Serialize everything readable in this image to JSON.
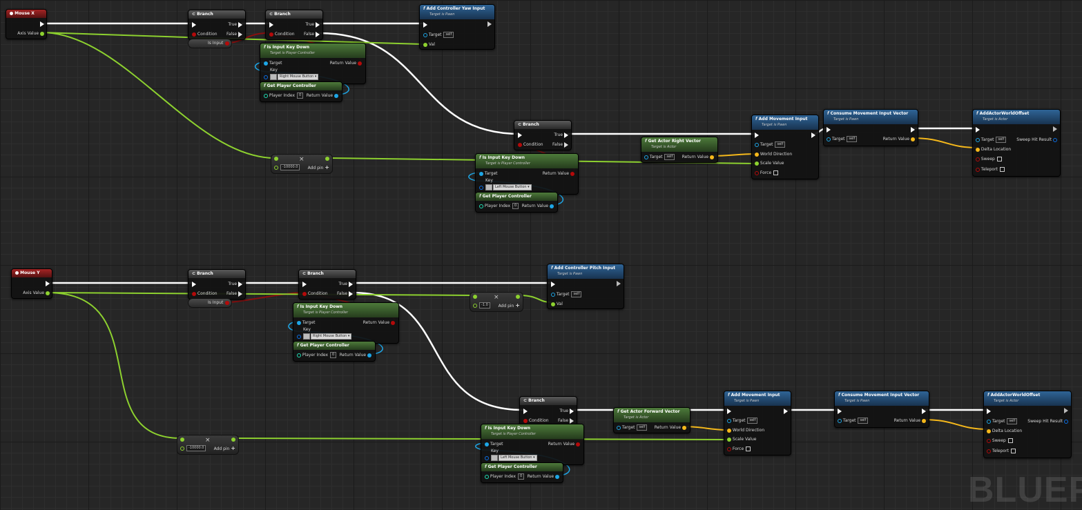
{
  "watermark": "BLUEP",
  "colors": {
    "exec": "#ffffff",
    "bool": "#8c0f0f",
    "float": "#8dd12f",
    "object": "#1ea6e6",
    "vector": "#f5b81b",
    "struct": "#0b6fe6",
    "red_pin": "#b30a0a"
  },
  "event_x": {
    "title": "Mouse X",
    "axis": "Axis Value"
  },
  "event_y": {
    "title": "Mouse Y",
    "axis": "Axis Value"
  },
  "branch": {
    "title": "Branch",
    "condition": "Condition",
    "true": "True",
    "false": "False"
  },
  "is_input": "Is Input",
  "add_yaw": {
    "title": "Add Controller Yaw Input",
    "sub": "Target is Pawn",
    "target": "Target",
    "self": "self",
    "val": "Val"
  },
  "add_pitch": {
    "title": "Add Controller Pitch Input",
    "sub": "Target is Pawn",
    "target": "Target",
    "self": "self",
    "val": "Val"
  },
  "is_key_down": {
    "title": "Is Input Key Down",
    "sub": "Target is Player Controller",
    "target": "Target",
    "ret": "Return Value",
    "key": "Key",
    "rmb": "Right Mouse Button",
    "lmb": "Left Mouse Button"
  },
  "get_pc": {
    "title": "Get Player Controller",
    "index_label": "Player Index",
    "index": "0",
    "ret": "Return Value"
  },
  "mult_x": {
    "value": "-10000.0",
    "add": "Add pin"
  },
  "mult_y_top": {
    "value": "-1.0",
    "add": "Add pin"
  },
  "mult_y_bottom": {
    "value": "-10000.0",
    "add": "Add pin"
  },
  "right_vec": {
    "title": "Get Actor Right Vector",
    "sub": "Target is Actor",
    "target": "Target",
    "self": "self",
    "ret": "Return Value"
  },
  "fwd_vec": {
    "title": "Get Actor Forward Vector",
    "sub": "Target is Actor",
    "target": "Target",
    "self": "self",
    "ret": "Return Value"
  },
  "add_move": {
    "title": "Add Movement Input",
    "sub": "Target is Pawn",
    "target": "Target",
    "self": "self",
    "world_dir": "World Direction",
    "scale": "Scale Value",
    "force": "Force"
  },
  "consume": {
    "title": "Consume Movement Input Vector",
    "sub": "Target is Pawn",
    "target": "Target",
    "self": "self",
    "ret": "Return Value"
  },
  "add_offset": {
    "title": "AddActorWorldOffset",
    "sub": "Target is Actor",
    "target": "Target",
    "self": "self",
    "sweep_hit": "Sweep Hit Result",
    "delta": "Delta Location",
    "sweep": "Sweep",
    "teleport": "Teleport"
  }
}
